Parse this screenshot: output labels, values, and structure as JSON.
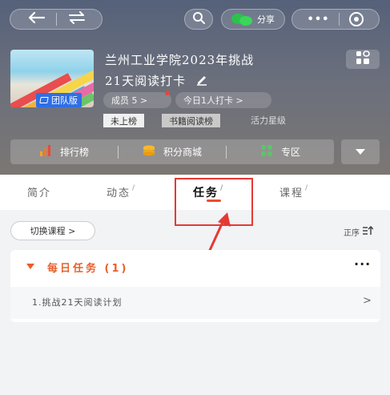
{
  "header": {
    "share_label": "分享",
    "group_title_line1": "兰州工业学院2023年挑战",
    "group_title_line2": "21天阅读打卡",
    "team_badge": "团队版",
    "members_chip": "成员 5 >",
    "checkin_chip": "今日1人打卡 >",
    "rank_off": "未上榜",
    "rank_book": "书籍阅读榜",
    "vitality": "活力星级",
    "quick_actions": [
      {
        "label": "排行榜",
        "icon": "bar-chart-icon"
      },
      {
        "label": "积分商城",
        "icon": "coin-stack-icon"
      },
      {
        "label": "专区",
        "icon": "grid-icon"
      }
    ]
  },
  "tabs": [
    {
      "label": "简介"
    },
    {
      "label": "动态"
    },
    {
      "label": "任务",
      "active": true
    },
    {
      "label": "课程"
    }
  ],
  "content": {
    "switch_course": "切换课程 >",
    "order_label": "正序",
    "section_title": "每日任务 (1)",
    "more": "···",
    "task": "1.挑战21天阅读计划",
    "task_arrow": ">"
  },
  "colors": {
    "accent": "#ec4d2b",
    "badge_blue": "#2f6ee6",
    "wechat_green": "#2bc24a",
    "annotation_red": "#e53935"
  }
}
